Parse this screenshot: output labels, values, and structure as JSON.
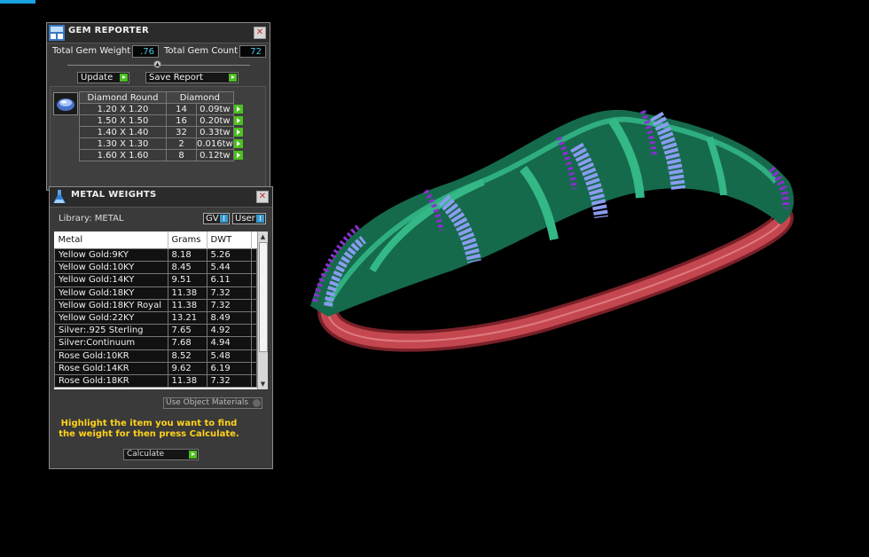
{
  "gem_reporter": {
    "title": "GEM REPORTER",
    "total_weight_label": "Total Gem Weight",
    "total_weight_value": ".76",
    "total_count_label": "Total Gem Count",
    "total_count_value": "72",
    "update_label": "Update",
    "save_report_label": "Save Report",
    "table_header_shape": "Diamond Round",
    "table_header_type": "Diamond",
    "rows": [
      {
        "size": "1.20 X 1.20",
        "count": "14",
        "weight": "0.09tw"
      },
      {
        "size": "1.50 X 1.50",
        "count": "16",
        "weight": "0.20tw"
      },
      {
        "size": "1.40 X 1.40",
        "count": "32",
        "weight": "0.33tw"
      },
      {
        "size": "1.30 X 1.30",
        "count": "2",
        "weight": "0.016tw"
      },
      {
        "size": "1.60 X 1.60",
        "count": "8",
        "weight": "0.12tw"
      }
    ]
  },
  "metal_weights": {
    "title": "METAL WEIGHTS",
    "library_label": "Library: METAL",
    "gv_label": "GV",
    "user_label": "User",
    "columns": [
      "Metal",
      "Grams",
      "DWT"
    ],
    "rows": [
      {
        "metal": "Yellow Gold:9KY",
        "grams": "8.18",
        "dwt": "5.26"
      },
      {
        "metal": "Yellow Gold:10KY",
        "grams": "8.45",
        "dwt": "5.44"
      },
      {
        "metal": "Yellow Gold:14KY",
        "grams": "9.51",
        "dwt": "6.11"
      },
      {
        "metal": "Yellow Gold:18KY",
        "grams": "11.38",
        "dwt": "7.32"
      },
      {
        "metal": "Yellow Gold:18KY Royal",
        "grams": "11.38",
        "dwt": "7.32"
      },
      {
        "metal": "Yellow Gold:22KY",
        "grams": "13.21",
        "dwt": "8.49"
      },
      {
        "metal": "Silver:.925 Sterling",
        "grams": "7.65",
        "dwt": "4.92"
      },
      {
        "metal": "Silver:Continuum",
        "grams": "7.68",
        "dwt": "4.94"
      },
      {
        "metal": "Rose Gold:10KR",
        "grams": "8.52",
        "dwt": "5.48"
      },
      {
        "metal": "Rose Gold:14KR",
        "grams": "9.62",
        "dwt": "6.19"
      },
      {
        "metal": "Rose Gold:18KR",
        "grams": "11.38",
        "dwt": "7.32"
      }
    ],
    "use_object_materials_label": "Use Object Materials",
    "hint_text": "Highlight the item you want to find the weight for then press Calculate.",
    "calculate_label": "Calculate"
  },
  "colors": {
    "panel_bg": "#3a3a3a",
    "value_text": "#47c8e8",
    "play_green": "#4cc020",
    "hint_yellow": "#ffd21a",
    "bangle_green": "#1f8a62",
    "gem_blue": "#8a9cf0",
    "gem_purple": "#8a2fd0",
    "band_red": "#b83a42"
  }
}
